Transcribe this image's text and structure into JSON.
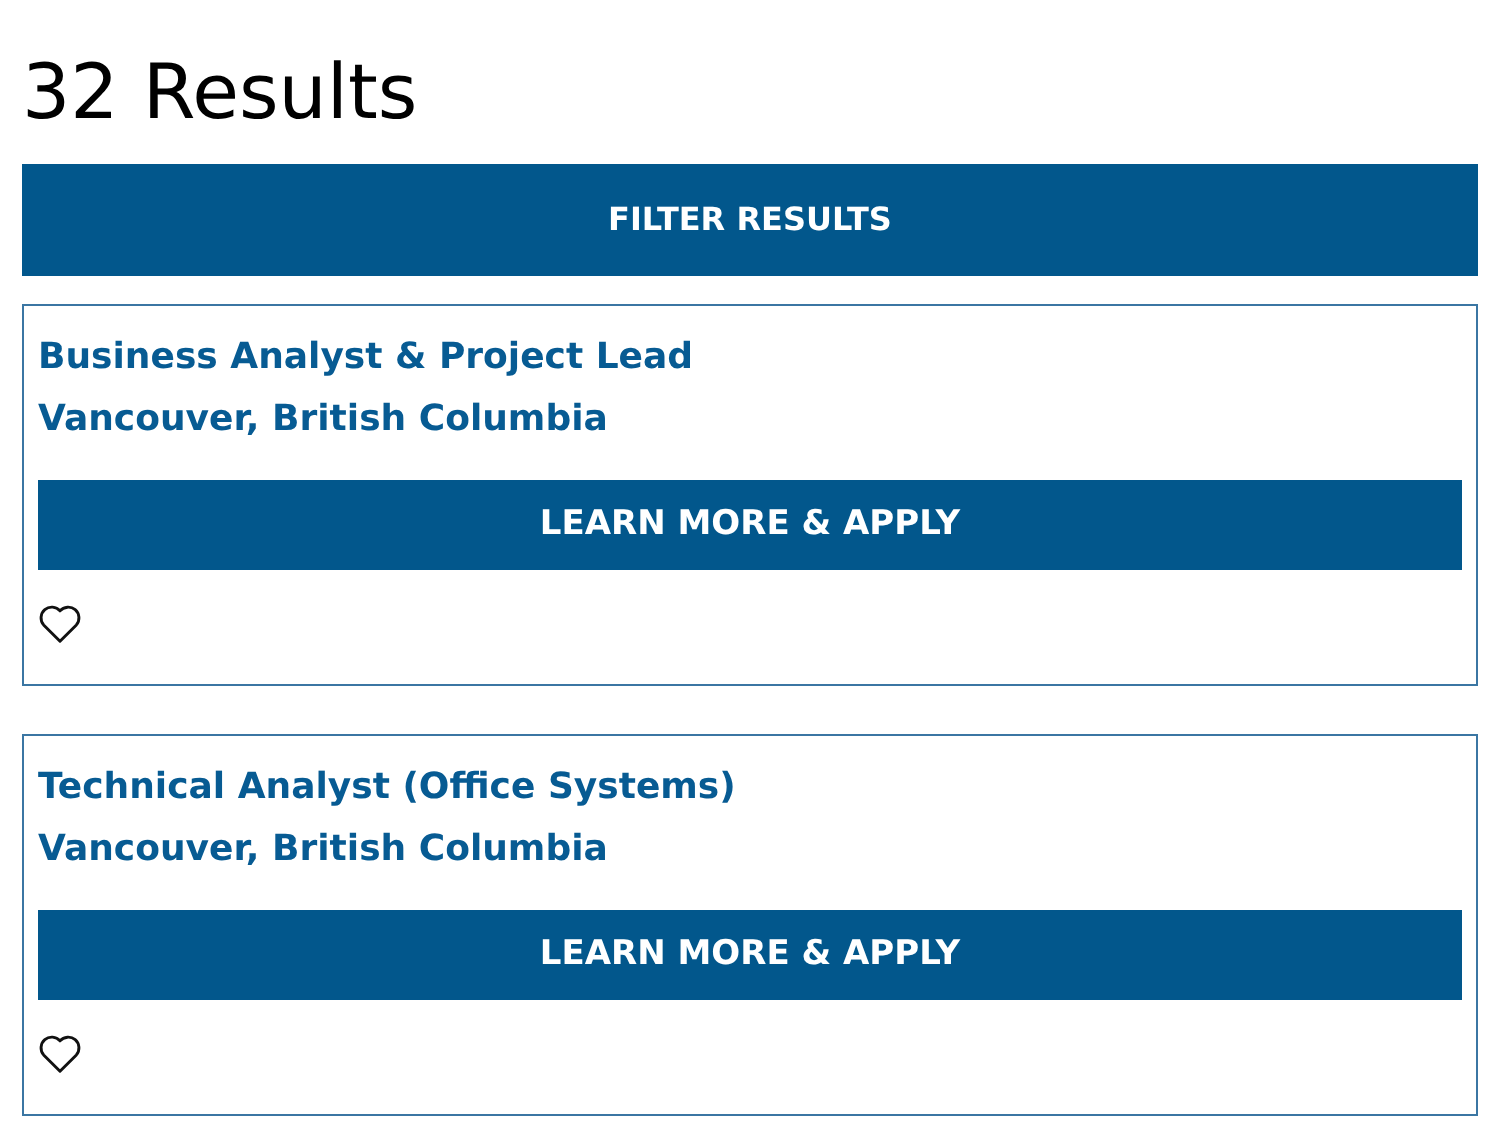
{
  "heading": "32 Results",
  "filter_button": "FILTER RESULTS",
  "jobs": [
    {
      "title": "Business Analyst & Project Lead",
      "location": "Vancouver, British Columbia",
      "button": "LEARN MORE & APPLY"
    },
    {
      "title": "Technical Analyst (Office Systems)",
      "location": "Vancouver, British Columbia",
      "button": "LEARN MORE & APPLY"
    }
  ]
}
